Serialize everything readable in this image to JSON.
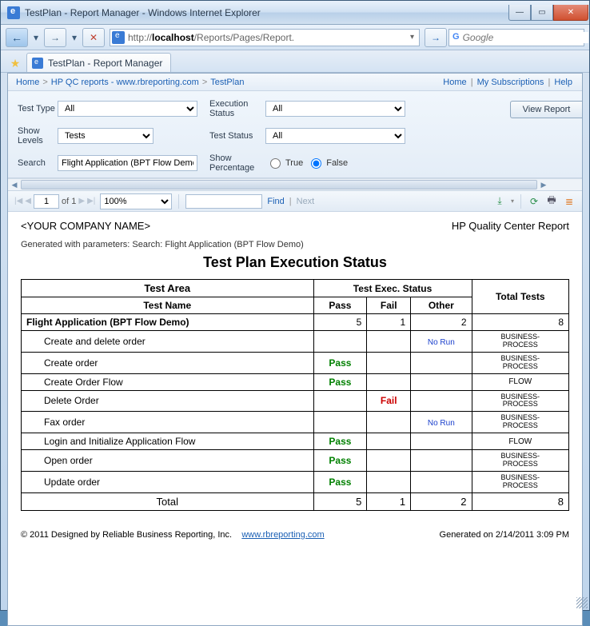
{
  "window": {
    "title": "TestPlan - Report Manager - Windows Internet Explorer",
    "url_prefix": "http://",
    "url_host": "localhost",
    "url_path": "/Reports/Pages/Report.",
    "search_placeholder": "Google"
  },
  "tab": {
    "title": "TestPlan - Report Manager"
  },
  "breadcrumb": {
    "items": [
      "Home",
      "HP QC reports - www.rbreporting.com",
      "TestPlan"
    ],
    "right": [
      "Home",
      "My Subscriptions",
      "Help"
    ]
  },
  "params": {
    "test_type_label": "Test Type",
    "test_type_value": "All",
    "exec_status_label": "Execution Status",
    "exec_status_value": "All",
    "show_levels_label": "Show Levels",
    "show_levels_value": "Tests",
    "test_status_label": "Test Status",
    "test_status_value": "All",
    "search_label": "Search",
    "search_value": "Flight Application (BPT Flow Demo)",
    "show_pct_label": "Show Percentage",
    "show_pct_true": "True",
    "show_pct_false": "False",
    "show_pct_selected": "false",
    "view_button": "View Report"
  },
  "viewer": {
    "page_current": "1",
    "page_of_label": "of 1",
    "zoom": "100%",
    "find_label": "Find",
    "next_label": "Next"
  },
  "report": {
    "company": "<YOUR COMPANY NAME>",
    "subtitle": "HP Quality Center Report",
    "generated_params": "Generated with parameters: Search: Flight Application (BPT Flow Demo)",
    "title": "Test Plan Execution Status",
    "headers": {
      "area": "Test Area",
      "name": "Test Name",
      "exec": "Test Exec. Status",
      "pass": "Pass",
      "fail": "Fail",
      "other": "Other",
      "total": "Total Tests",
      "total_row": "Total"
    },
    "group": {
      "name": "Flight Application (BPT Flow Demo)",
      "pass": "5",
      "fail": "1",
      "other": "2",
      "total": "8"
    },
    "rows": [
      {
        "name": "Create and delete order",
        "pass": "",
        "fail": "",
        "other": "No Run",
        "type": "BUSINESS-PROCESS"
      },
      {
        "name": "Create order",
        "pass": "Pass",
        "fail": "",
        "other": "",
        "type": "BUSINESS-PROCESS"
      },
      {
        "name": "Create Order Flow",
        "pass": "Pass",
        "fail": "",
        "other": "",
        "type": "FLOW"
      },
      {
        "name": "Delete Order",
        "pass": "",
        "fail": "Fail",
        "other": "",
        "type": "BUSINESS-PROCESS"
      },
      {
        "name": "Fax order",
        "pass": "",
        "fail": "",
        "other": "No Run",
        "type": "BUSINESS-PROCESS"
      },
      {
        "name": "Login and Initialize Application Flow",
        "pass": "Pass",
        "fail": "",
        "other": "",
        "type": "FLOW"
      },
      {
        "name": "Open order",
        "pass": "Pass",
        "fail": "",
        "other": "",
        "type": "BUSINESS-PROCESS"
      },
      {
        "name": "Update order",
        "pass": "Pass",
        "fail": "",
        "other": "",
        "type": "BUSINESS-PROCESS"
      }
    ],
    "totals": {
      "pass": "5",
      "fail": "1",
      "other": "2",
      "total": "8"
    },
    "footer_copyright": "© 2011 Designed by Reliable Business Reporting, Inc.",
    "footer_link": "www.rbreporting.com",
    "footer_generated": "Generated on 2/14/2011 3:09 PM"
  }
}
